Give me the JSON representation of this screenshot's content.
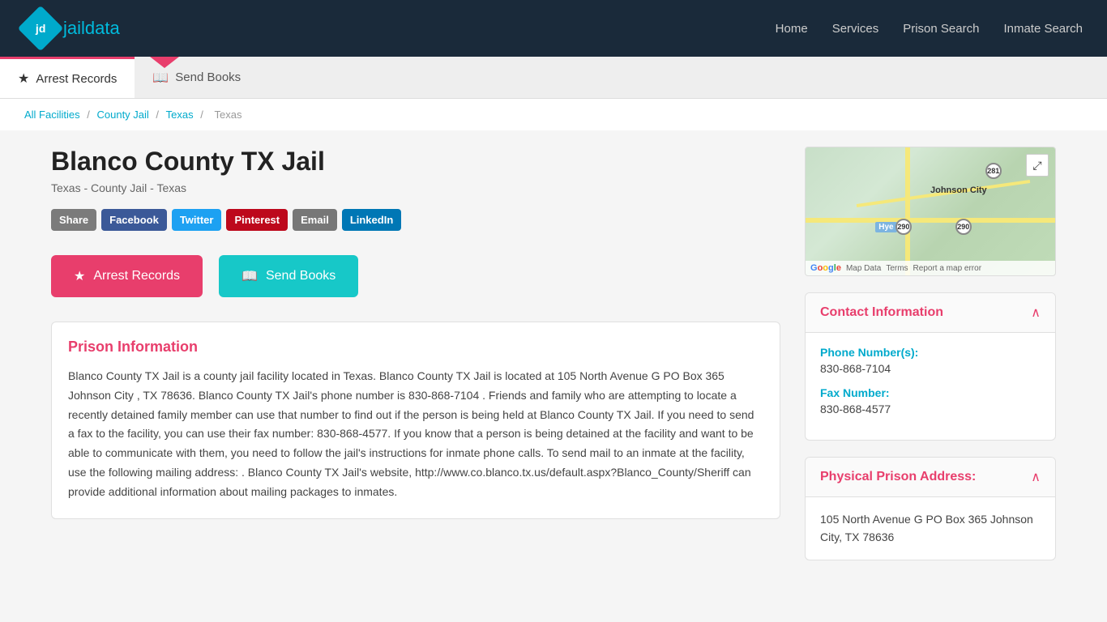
{
  "header": {
    "logo_jd": "jd",
    "logo_jail": "jail",
    "logo_data": "data",
    "nav": [
      {
        "label": "Home",
        "id": "home"
      },
      {
        "label": "Services",
        "id": "services"
      },
      {
        "label": "Prison Search",
        "id": "prison-search"
      },
      {
        "label": "Inmate Search",
        "id": "inmate-search"
      }
    ]
  },
  "tabs": [
    {
      "label": "Arrest Records",
      "icon": "★",
      "active": true
    },
    {
      "label": "Send Books",
      "icon": "📖",
      "active": false
    }
  ],
  "breadcrumb": {
    "items": [
      {
        "label": "All Facilities",
        "link": true
      },
      {
        "label": "County Jail",
        "link": true
      },
      {
        "label": "Texas",
        "link": true
      },
      {
        "label": "Texas",
        "link": false
      }
    ]
  },
  "facility": {
    "title": "Blanco County TX Jail",
    "subtitle": "Texas - County Jail - Texas",
    "description": "Blanco County TX Jail is a county jail facility located in Texas. Blanco County TX Jail is located at 105 North Avenue G PO Box 365 Johnson City , TX 78636. Blanco County TX Jail's phone number is 830-868-7104 . Friends and family who are attempting to locate a recently detained family member can use that number to find out if the person is being held at Blanco County TX Jail. If you need to send a fax to the facility, you can use their fax number: 830-868-4577. If you know that a person is being detained at the facility and want to be able to communicate with them, you need to follow the jail's instructions for inmate phone calls. To send mail to an inmate at the facility, use the following mailing address: . Blanco County TX Jail's website, http://www.co.blanco.tx.us/default.aspx?Blanco_County/Sheriff can provide additional information about mailing packages to inmates."
  },
  "action_buttons": {
    "arrest_records": "Arrest Records",
    "send_books": "Send Books"
  },
  "prison_info": {
    "section_title": "Prison Information"
  },
  "contact": {
    "section_title": "Contact Information",
    "phone_label": "Phone Number(s):",
    "phone_value": "830-868-7104",
    "fax_label": "Fax Number:",
    "fax_value": "830-868-4577"
  },
  "address": {
    "section_title": "Physical Prison Address:",
    "value": "105 North Avenue G PO Box 365 Johnson City, TX 78636"
  },
  "map": {
    "label_city": "Johnson City",
    "badge_290a": "290",
    "badge_290b": "290",
    "badge_281": "281",
    "label_hye": "Hye",
    "footer_mapdata": "Map Data",
    "footer_terms": "Terms",
    "footer_error": "Report a map error"
  },
  "social": [
    {
      "label": "Share",
      "class": "btn-share"
    },
    {
      "label": "Facebook",
      "class": "btn-fb"
    },
    {
      "label": "Twitter",
      "class": "btn-tw"
    },
    {
      "label": "Pinterest",
      "class": "btn-pin"
    },
    {
      "label": "Email",
      "class": "btn-email"
    },
    {
      "label": "LinkedIn",
      "class": "btn-li"
    }
  ]
}
